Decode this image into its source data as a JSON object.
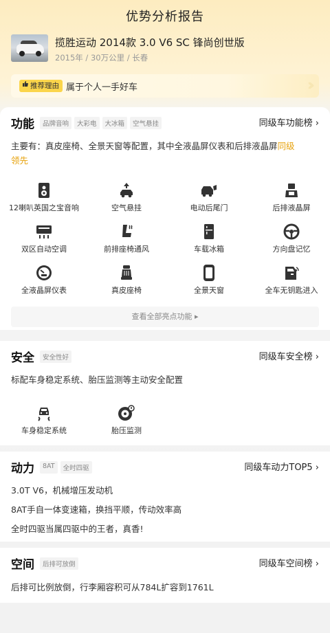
{
  "page_title": "优势分析报告",
  "car": {
    "name": "揽胜运动 2014款 3.0 V6 SC 锋尚创世版",
    "meta": "2015年 / 30万公里 / 长春"
  },
  "recommend": {
    "badge": "推荐理由",
    "text": "属于个人一手好车",
    "chevrons": "»"
  },
  "function": {
    "title": "功能",
    "tags": [
      "品牌音响",
      "大彩电",
      "大冰箱",
      "空气悬挂"
    ],
    "rank_link": "同级车功能榜 ›",
    "desc_prefix": "主要有：真皮座椅、全景天窗等配置，其中全液晶屏仪表和后排液晶屏",
    "desc_highlight_1": "同级",
    "desc_highlight_2": "领先",
    "features": [
      {
        "label": "12喇叭英国之宝音响",
        "icon": "speaker-icon"
      },
      {
        "label": "空气悬挂",
        "icon": "air-suspension-icon"
      },
      {
        "label": "电动后尾门",
        "icon": "power-tailgate-icon"
      },
      {
        "label": "后排液晶屏",
        "icon": "rear-screen-icon"
      },
      {
        "label": "双区自动空调",
        "icon": "dual-zone-ac-icon"
      },
      {
        "label": "前排座椅通风",
        "icon": "seat-ventilation-icon"
      },
      {
        "label": "车载冰箱",
        "icon": "car-fridge-icon"
      },
      {
        "label": "方向盘记忆",
        "icon": "steering-memory-icon"
      },
      {
        "label": "全液晶屏仪表",
        "icon": "lcd-dashboard-icon"
      },
      {
        "label": "真皮座椅",
        "icon": "leather-seat-icon"
      },
      {
        "label": "全景天窗",
        "icon": "panoramic-sunroof-icon"
      },
      {
        "label": "全车无钥匙进入",
        "icon": "keyless-entry-icon"
      }
    ],
    "more_label": "查看全部亮点功能 ▸"
  },
  "safety": {
    "title": "安全",
    "tags": [
      "安全性好"
    ],
    "rank_link": "同级车安全榜 ›",
    "desc": "标配车身稳定系统、胎压监测等主动安全配置",
    "features": [
      {
        "label": "车身稳定系统",
        "icon": "stability-control-icon"
      },
      {
        "label": "胎压监测",
        "icon": "tire-pressure-icon"
      }
    ]
  },
  "power": {
    "title": "动力",
    "tags": [
      "8AT",
      "全时四驱"
    ],
    "rank_link": "同级车动力TOP5 ›",
    "lines": [
      "3.0T V6，机械增压发动机",
      "8AT手自一体变速箱，换挡平顺，传动效率高",
      "全时四驱当属四驱中的王者，真香!"
    ]
  },
  "space": {
    "title": "空间",
    "tags": [
      "后排可放倒"
    ],
    "rank_link": "同级车空间榜 ›",
    "desc": "后排可比例放倒，行李厢容积可从784L扩容到1761L"
  },
  "colors": {
    "accent": "#e7a20c",
    "badge": "#fbd54b",
    "header_bg": "#fdecc0"
  }
}
